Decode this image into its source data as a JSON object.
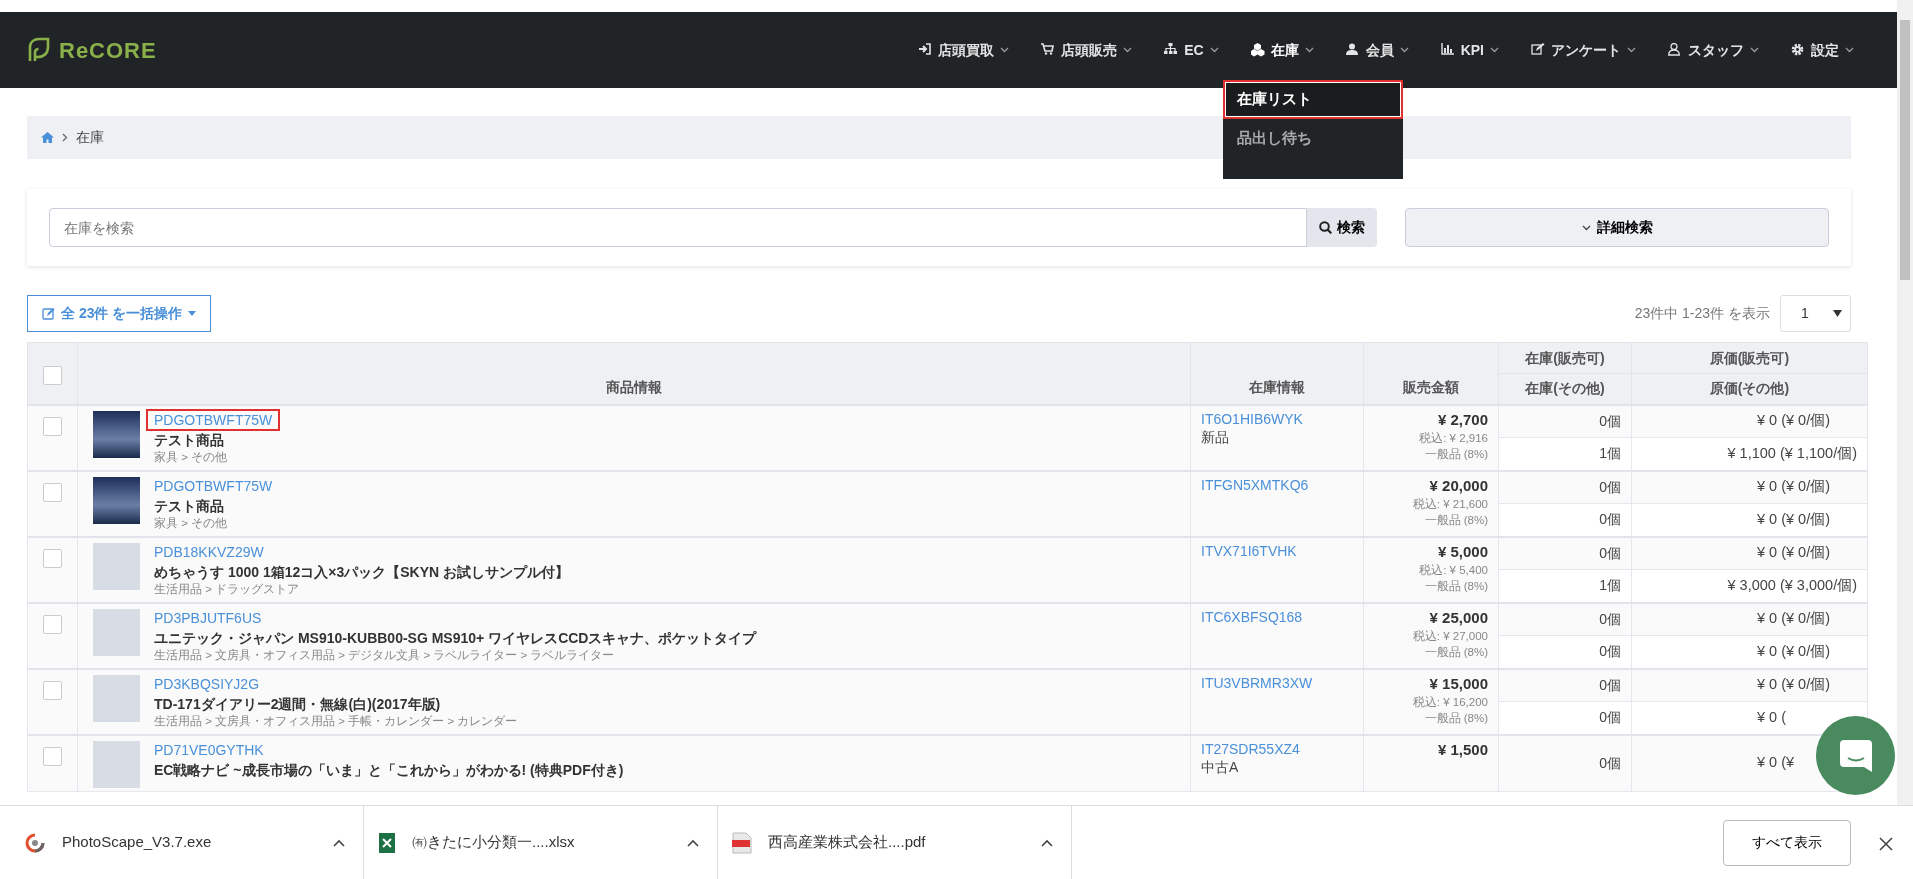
{
  "navbar": {
    "logo": "ReCORE",
    "items": [
      {
        "label": "店頭買取",
        "expanded": false
      },
      {
        "label": "店頭販売",
        "expanded": false
      },
      {
        "label": "EC",
        "expanded": false
      },
      {
        "label": "在庫",
        "expanded": true,
        "menu": [
          {
            "label": "在庫リスト",
            "selected": true,
            "highlighted": true
          },
          {
            "label": "品出し待ち",
            "selected": false,
            "highlighted": false
          }
        ]
      },
      {
        "label": "会員",
        "expanded": false
      },
      {
        "label": "KPI",
        "expanded": false
      },
      {
        "label": "アンケート",
        "expanded": false
      },
      {
        "label": "スタッフ",
        "expanded": false
      },
      {
        "label": "設定",
        "expanded": false
      }
    ]
  },
  "breadcrumb": [
    "在庫"
  ],
  "search": {
    "placeholder": "在庫を検索",
    "button": "検索",
    "advanced": "詳細検索"
  },
  "bulk_button": "全 23件 を一括操作",
  "pagination": {
    "summary": "23件中 1-23件 を表示",
    "page": "1"
  },
  "table": {
    "select_all_checked": false,
    "columns": [
      "商品情報",
      "在庫情報",
      "販売金額",
      "在庫(販売可)",
      "在庫(その他)",
      "原価(販売可)",
      "原価(その他)"
    ],
    "rows": [
      {
        "checked": false,
        "code": "PDGOTBWFT75W",
        "highlighted": true,
        "name": "テスト商品",
        "category": "家具 > その他",
        "stock_code": "IT6O1HIB6WYK",
        "condition": "新品",
        "price": "¥ 2,700",
        "tax": "税込: ¥ 2,916",
        "tax_class": "一般品 (8%)",
        "stock": [
          {
            "count": "0個",
            "cost": "¥ 0 (¥ 0/個)"
          },
          {
            "count": "1個",
            "cost": "¥ 1,100 (¥ 1,100/個)"
          }
        ]
      },
      {
        "checked": false,
        "code": "PDGOTBWFT75W",
        "highlighted": false,
        "name": "テスト商品",
        "category": "家具 > その他",
        "stock_code": "ITFGN5XMTKQ6",
        "price": "¥ 20,000",
        "tax": "税込: ¥ 21,600",
        "tax_class": "一般品 (8%)",
        "stock": [
          {
            "count": "0個",
            "cost": "¥ 0 (¥ 0/個)"
          },
          {
            "count": "0個",
            "cost": "¥ 0 (¥ 0/個)"
          }
        ]
      },
      {
        "checked": false,
        "code": "PDB18KKVZ29W",
        "highlighted": false,
        "name": "めちゃうす 1000 1箱12コ入×3パック【SKYN お試しサンプル付】",
        "category": "生活用品 > ドラッグストア",
        "stock_code": "ITVX71I6TVHK",
        "price": "¥ 5,000",
        "tax": "税込: ¥ 5,400",
        "tax_class": "一般品 (8%)",
        "stock": [
          {
            "count": "0個",
            "cost": "¥ 0 (¥ 0/個)"
          },
          {
            "count": "1個",
            "cost": "¥ 3,000 (¥ 3,000/個)"
          }
        ]
      },
      {
        "checked": false,
        "code": "PD3PBJUTF6US",
        "highlighted": false,
        "name": "ユニテック・ジャパン MS910-KUBB00-SG MS910+ ワイヤレスCCDスキャナ、ポケットタイプ",
        "category": "生活用品 > 文房具・オフィス用品 > デジタル文具 > ラベルライター > ラベルライター",
        "stock_code": "ITC6XBFSQ168",
        "price": "¥ 25,000",
        "tax": "税込: ¥ 27,000",
        "tax_class": "一般品 (8%)",
        "stock": [
          {
            "count": "0個",
            "cost": "¥ 0 (¥ 0/個)"
          },
          {
            "count": "0個",
            "cost": "¥ 0 (¥ 0/個)"
          }
        ]
      },
      {
        "checked": false,
        "code": "PD3KBQSIYJ2G",
        "highlighted": false,
        "name": "TD-171ダイアリー2週間・無線(白)(2017年版)",
        "category": "生活用品 > 文房具・オフィス用品 > 手帳・カレンダー > カレンダー",
        "stock_code": "ITU3VBRMR3XW",
        "price": "¥ 15,000",
        "tax": "税込: ¥ 16,200",
        "tax_class": "一般品 (8%)",
        "stock": [
          {
            "count": "0個",
            "cost": "¥ 0 (¥ 0/個)"
          },
          {
            "count": "0個",
            "cost": "¥ 0 ("
          }
        ]
      },
      {
        "checked": false,
        "code": "PD71VE0GYTHK",
        "highlighted": false,
        "name": "EC戦略ナビ ~成長市場の「いま」と「これから」がわかる! (特典PDF付き)",
        "stock_code": "IT27SDR55XZ4",
        "condition": "中古A",
        "price": "¥ 1,500",
        "stock": [
          {
            "count": "0個",
            "cost": "¥ 0 (¥"
          }
        ]
      }
    ]
  },
  "downloads": {
    "files": [
      {
        "name": "PhotoScape_V3.7.exe"
      },
      {
        "name": "㈲きたに小分類一....xlsx"
      },
      {
        "name": "西高産業株式会社....pdf"
      }
    ],
    "show_all": "すべて表示"
  }
}
